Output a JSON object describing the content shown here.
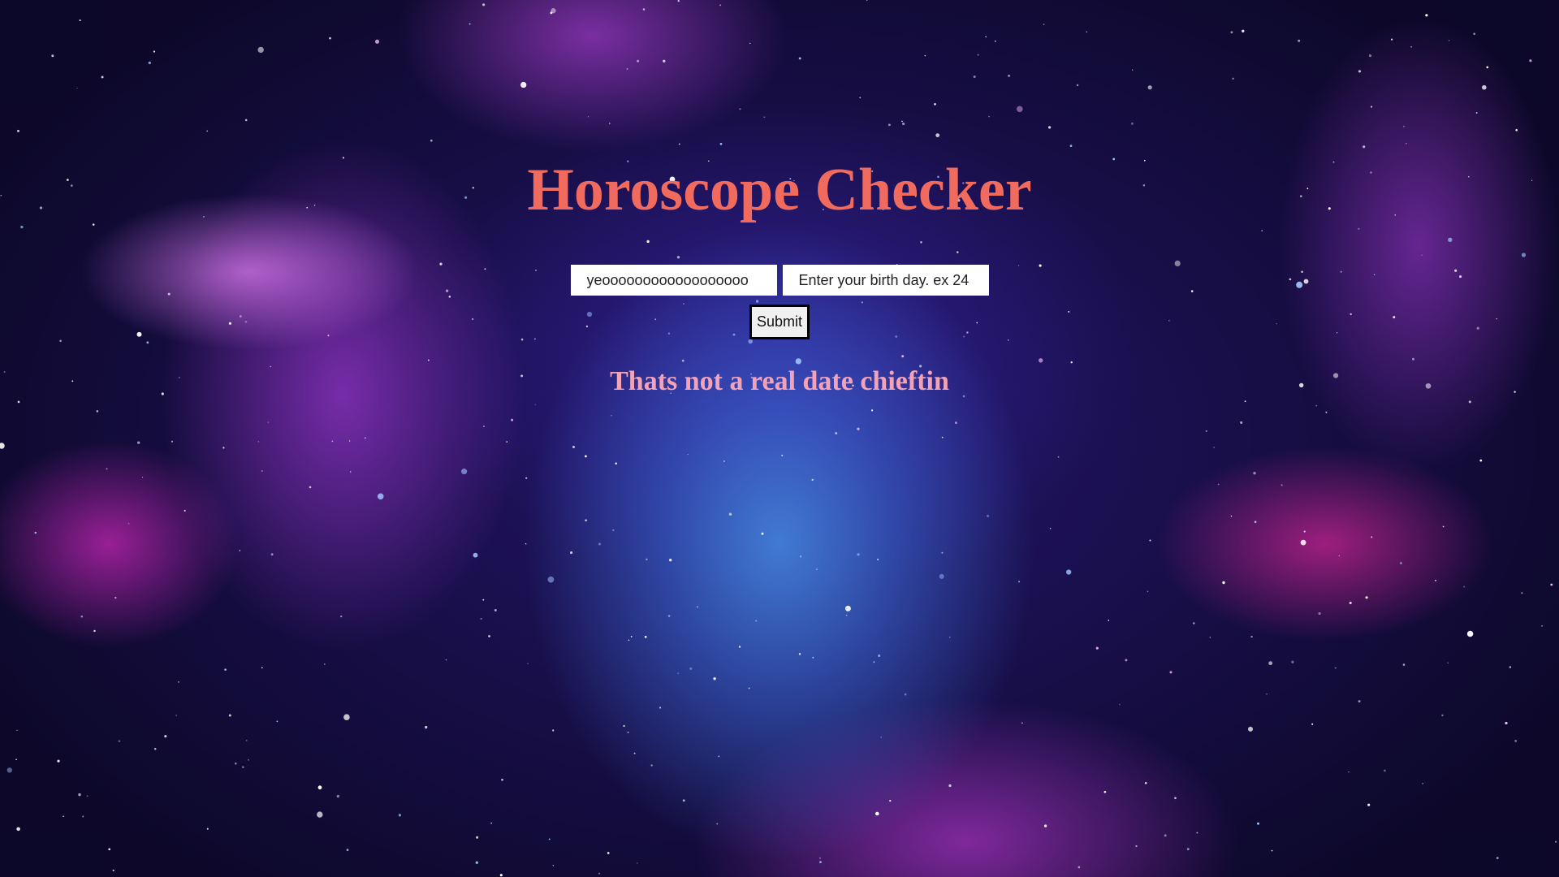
{
  "page": {
    "title": "Horoscope Checker",
    "background": "galaxy-nebula-image"
  },
  "form": {
    "name_input": {
      "value": "yeoooooooooooooooooo",
      "placeholder": ""
    },
    "day_input": {
      "value": "",
      "placeholder": "Enter your birth day. ex 24"
    },
    "submit_label": "Submit"
  },
  "result": {
    "message": "Thats not a real date chieftin"
  },
  "colors": {
    "title": "#f16a5e",
    "message": "#f4a3b6",
    "input_bg": "#ffffff",
    "button_bg": "#f0f0f0",
    "button_border": "#000000"
  }
}
